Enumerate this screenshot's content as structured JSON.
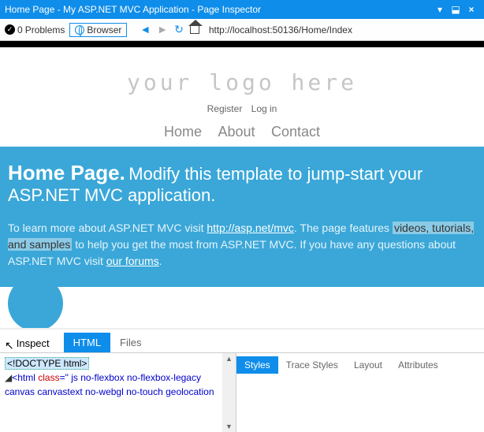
{
  "window": {
    "title": "Home Page - My ASP.NET MVC Application - Page Inspector",
    "dropdown": "▾",
    "pin": "⬓",
    "close": "×"
  },
  "toolbar": {
    "problems_count": "0",
    "problems_label": "Problems",
    "browser_label": "Browser",
    "url": "http://localhost:50136/Home/Index"
  },
  "page": {
    "logo": "your logo here",
    "register": "Register",
    "login": "Log in",
    "nav": {
      "home": "Home",
      "about": "About",
      "contact": "Contact"
    },
    "hero_title": "Home Page.",
    "hero_sub": "Modify this template to jump-start your ASP.NET MVC application.",
    "para1": "To learn more about ASP.NET MVC visit ",
    "link1": "http://asp.net/mvc",
    "para2": ". The page features ",
    "hl": "videos, tutorials, and samples",
    "para3": " to help you get the most from ASP.NET MVC. If you have any questions about ASP.NET MVC visit ",
    "link2": "our forums",
    "para4": "."
  },
  "inspector": {
    "inspect": "Inspect",
    "tabs": {
      "html": "HTML",
      "files": "Files"
    },
    "code": {
      "l1": "<!DOCTYPE html>",
      "l2a": "<",
      "l2b": "html",
      "l2c": "class",
      "l2d": "=\" js no-flexbox no-flexbox-legacy canvas canvastext no-webgl no-touch geolocation"
    },
    "side_tabs": {
      "styles": "Styles",
      "trace": "Trace Styles",
      "layout": "Layout",
      "attributes": "Attributes"
    }
  }
}
